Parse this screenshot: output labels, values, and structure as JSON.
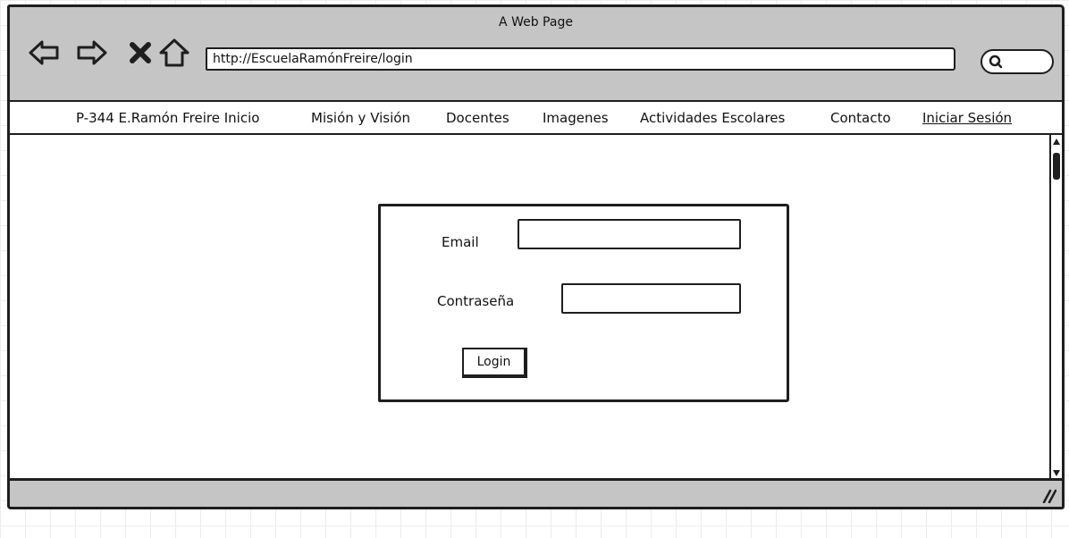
{
  "window": {
    "title": "A Web Page",
    "url": "http://EscuelaRamónFreire/login"
  },
  "nav": {
    "items": [
      {
        "label": "P-344 E.Ramón Freire Inicio"
      },
      {
        "label": "Misión y Visión"
      },
      {
        "label": "Docentes"
      },
      {
        "label": "Imagenes"
      },
      {
        "label": "Actividades Escolares"
      },
      {
        "label": "Contacto"
      },
      {
        "label": "Iniciar Sesión",
        "active": true
      }
    ]
  },
  "login": {
    "email_label": "Email",
    "password_label": "Contraseña",
    "button_label": "Login"
  },
  "icons": [
    "back-arrow-icon",
    "forward-arrow-icon",
    "stop-icon",
    "home-icon",
    "search-icon",
    "resize-grip-icon"
  ],
  "colors": {
    "chrome": "#c5c5c5",
    "stroke": "#1e1e1e"
  }
}
